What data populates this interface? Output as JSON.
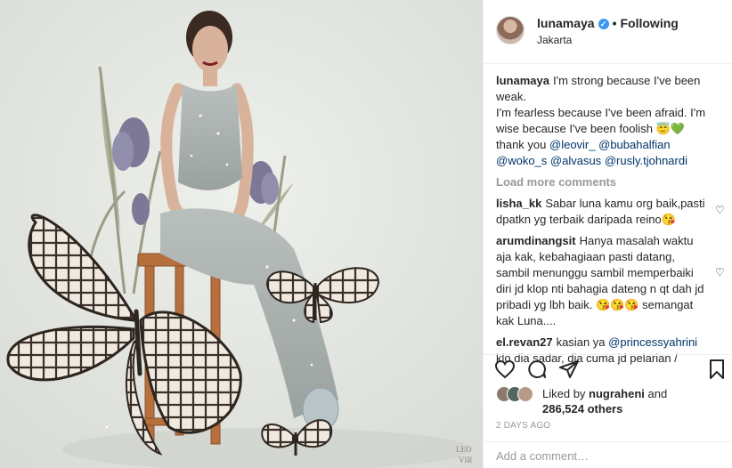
{
  "media": {
    "watermark": "LEO VIR",
    "colors": {
      "background": "#e6e8e3",
      "dress": "#a9b0ad",
      "stool": "#b5703e",
      "butterfly": "#f1ece4",
      "iris": "#7c7896"
    }
  },
  "header": {
    "username": "lunamaya",
    "verified_icon": "verified-badge-icon",
    "separator": "•",
    "follow_status": "Following",
    "location": "Jakarta"
  },
  "comments": {
    "caption": {
      "user": "lunamaya",
      "text": "I'm strong because I've been weak.\nI'm fearless because I've been afraid. I'm wise because I've been foolish 😇💚 thank you",
      "mentions": [
        "@leovir_",
        "@bubahalfian",
        "@woko_s",
        "@alvasus",
        "@rusly.tjohnardi"
      ]
    },
    "load_more": "Load more comments",
    "items": [
      {
        "user": "lisha_kk",
        "text": "Sabar luna kamu org baik,pasti dpatkn yg terbaik daripada reino😘"
      },
      {
        "user": "arumdinangsit",
        "text": "Hanya masalah waktu aja kak, kebahagiaan pasti datang, sambil menunggu sambil memperbaiki diri jd klop nti bahagia dateng n qt dah jd pribadi yg lbh baik. 😘😘😘 semangat kak Luna...."
      },
      {
        "user": "el.revan27",
        "text": "kasian ya",
        "mention": "@princessyahrini",
        "text2": "klo dia sadar, dia cuma jd pelarian /"
      }
    ]
  },
  "actions": {
    "like_icon": "heart-icon",
    "comment_icon": "comment-icon",
    "share_icon": "share-icon",
    "save_icon": "bookmark-icon"
  },
  "likes": {
    "prefix": "Liked by",
    "user": "nugraheni",
    "connector": "and",
    "count": "286,524 others"
  },
  "timestamp": "2 DAYS AGO",
  "add_comment": {
    "placeholder": "Add a comment…"
  }
}
